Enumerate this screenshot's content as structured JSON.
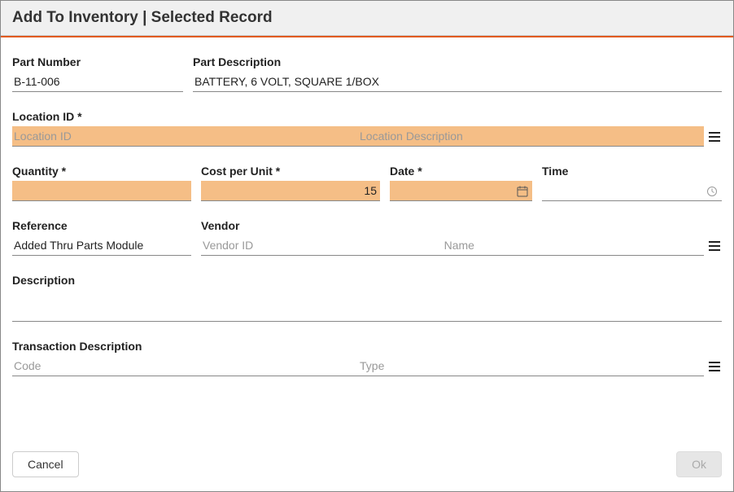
{
  "title": "Add To Inventory | Selected Record",
  "fields": {
    "part_number": {
      "label": "Part Number",
      "value": "B-11-006"
    },
    "part_description": {
      "label": "Part Description",
      "value": "BATTERY, 6 VOLT, SQUARE 1/BOX"
    },
    "location_id": {
      "label": "Location ID *",
      "placeholder_id": "Location ID",
      "placeholder_desc": "Location Description"
    },
    "quantity": {
      "label": "Quantity *",
      "value": ""
    },
    "cost_per_unit": {
      "label": "Cost per Unit *",
      "value": "15"
    },
    "date": {
      "label": "Date *",
      "value": ""
    },
    "time": {
      "label": "Time",
      "value": ""
    },
    "reference": {
      "label": "Reference",
      "value": "Added Thru Parts Module"
    },
    "vendor": {
      "label": "Vendor",
      "placeholder_id": "Vendor ID",
      "placeholder_name": "Name"
    },
    "description": {
      "label": "Description",
      "value": ""
    },
    "transaction_description": {
      "label": "Transaction Description",
      "placeholder_code": "Code",
      "placeholder_type": "Type"
    }
  },
  "buttons": {
    "cancel": "Cancel",
    "ok": "Ok"
  }
}
